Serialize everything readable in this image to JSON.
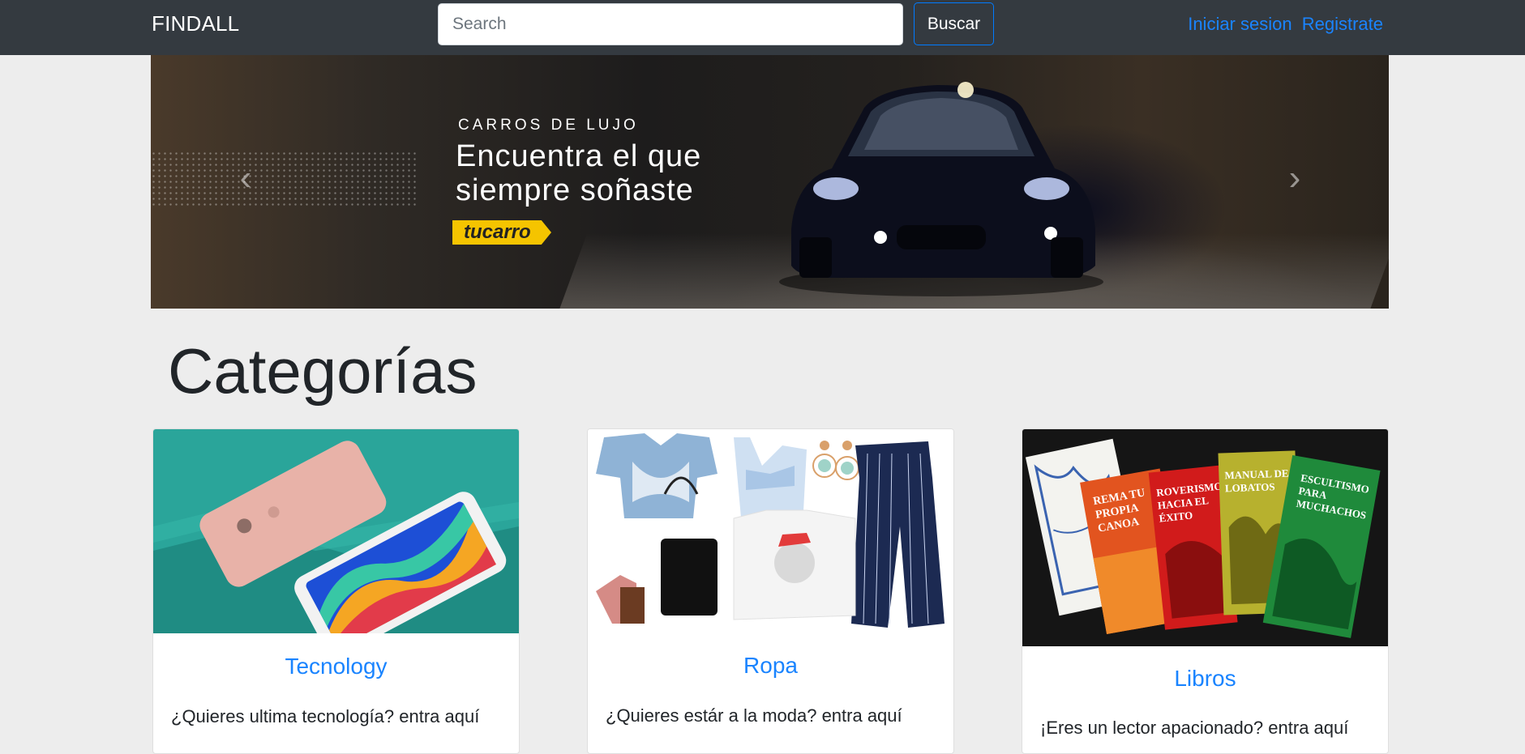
{
  "navbar": {
    "brand": "FINDALL",
    "search_placeholder": "Search",
    "search_button": "Buscar",
    "login_link": "Iniciar sesion",
    "register_link": "Registrate"
  },
  "carousel": {
    "kicker": "CARROS DE LUJO",
    "headline_line1": "Encuentra el que",
    "headline_line2": "siempre soñaste",
    "logo_text": "tucarro",
    "prev_icon": "‹",
    "next_icon": "›"
  },
  "categories": {
    "title": "Categorías",
    "cards": [
      {
        "title": "Tecnology",
        "text": "¿Quieres ultima tecnología? entra aquí"
      },
      {
        "title": "Ropa",
        "text": "¿Quieres estár a la moda? entra aquí"
      },
      {
        "title": "Libros",
        "text": "¡Eres un lector apacionado? entra aquí"
      }
    ]
  }
}
